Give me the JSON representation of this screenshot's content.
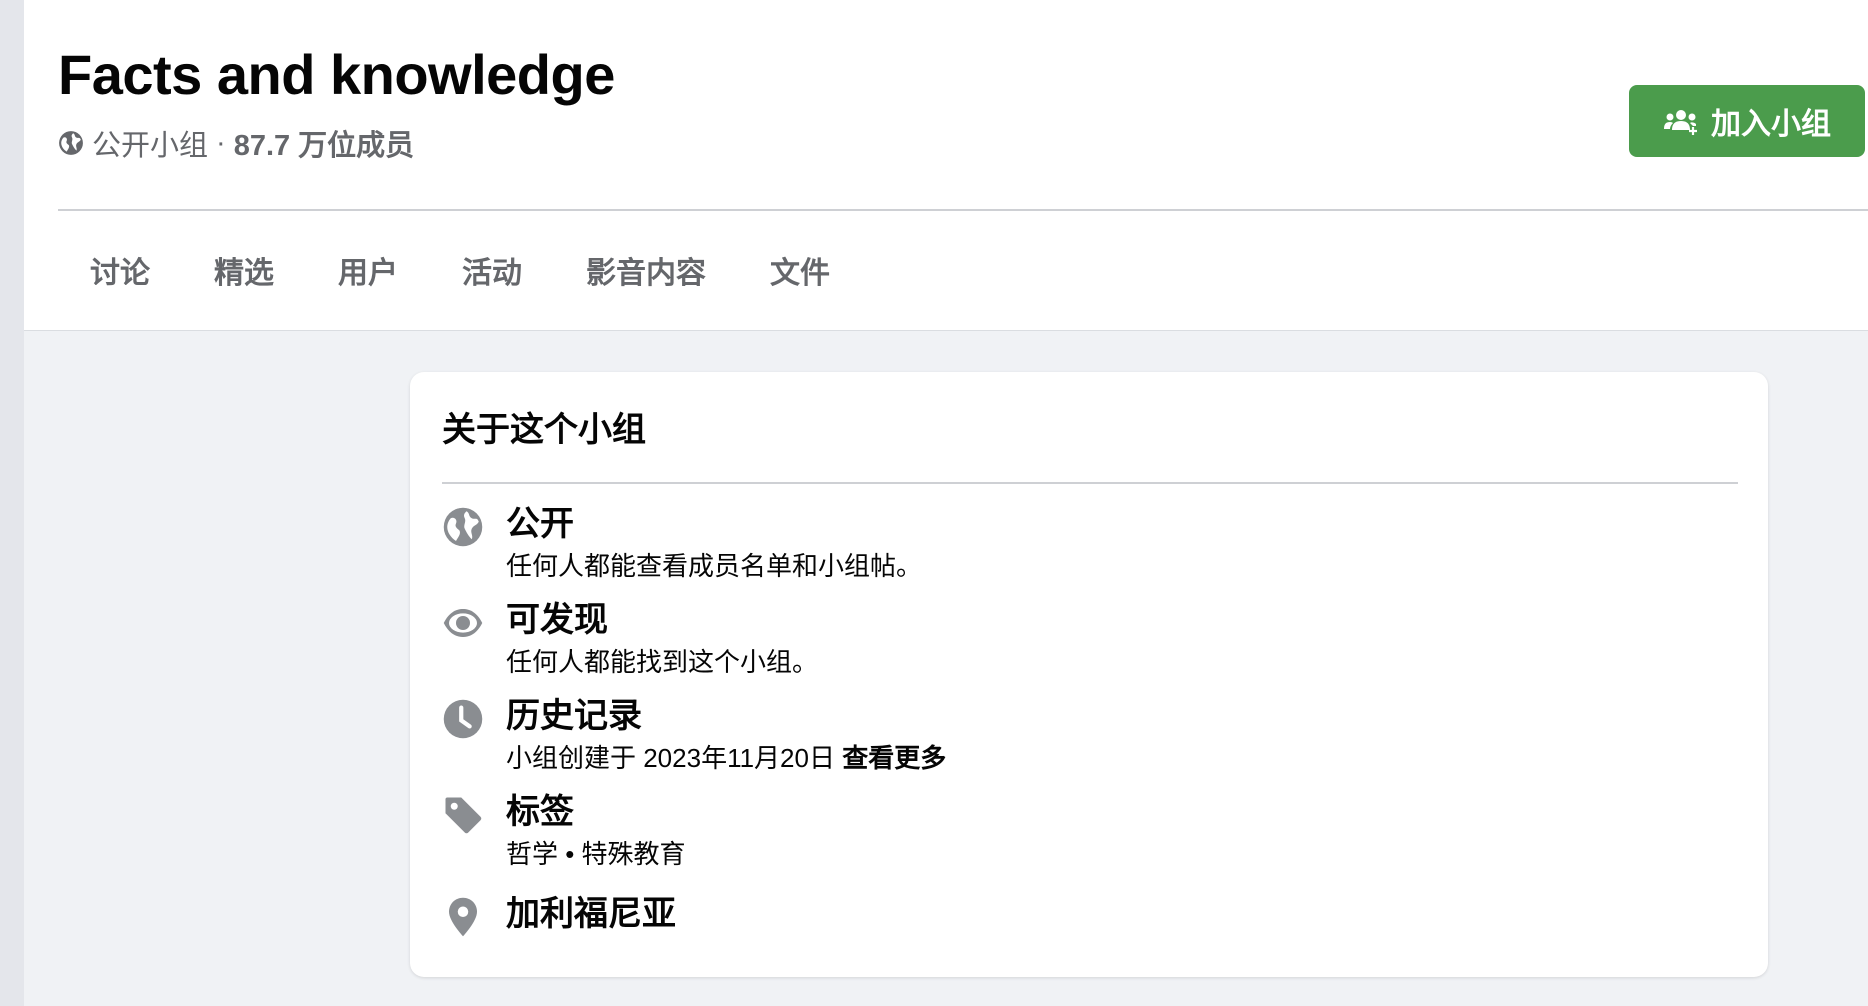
{
  "group": {
    "title": "Facts and knowledge",
    "privacy": "公开小组",
    "separator": " · ",
    "members": "87.7 万位成员",
    "join_label": "加入小组"
  },
  "tabs": [
    {
      "label": "讨论"
    },
    {
      "label": "精选"
    },
    {
      "label": "用户"
    },
    {
      "label": "活动"
    },
    {
      "label": "影音内容"
    },
    {
      "label": "文件"
    }
  ],
  "about": {
    "title": "关于这个小组",
    "items": [
      {
        "icon": "globe-icon",
        "title": "公开",
        "desc": "任何人都能查看成员名单和小组帖。"
      },
      {
        "icon": "eye-icon",
        "title": "可发现",
        "desc": "任何人都能找到这个小组。"
      },
      {
        "icon": "clock-icon",
        "title": "历史记录",
        "desc": "小组创建于 2023年11月20日 ",
        "link": "查看更多"
      },
      {
        "icon": "tag-icon",
        "title": "标签",
        "desc": "哲学 • 特殊教育"
      },
      {
        "icon": "location-pin-icon",
        "title": "加利福尼亚"
      }
    ]
  },
  "colors": {
    "join_button": "#4b9c4c",
    "secondary_text": "#65676b",
    "icon_gray": "#65676b",
    "page_background": "#f0f2f5"
  }
}
